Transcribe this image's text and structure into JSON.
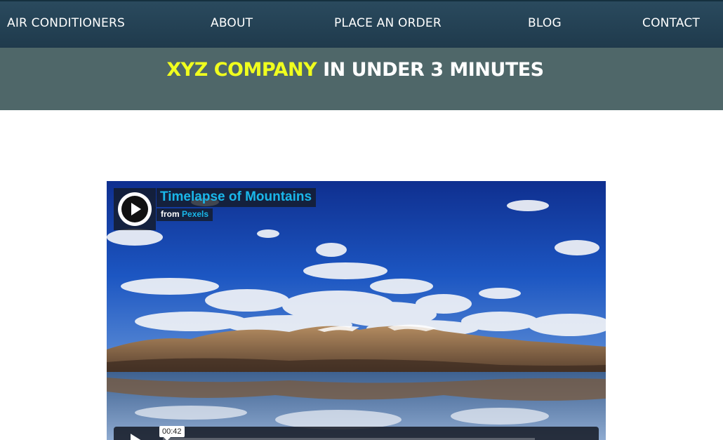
{
  "nav": {
    "items": [
      {
        "label": "AIR CONDITIONERS"
      },
      {
        "label": "ABOUT"
      },
      {
        "label": "PLACE AN ORDER"
      },
      {
        "label": "BLOG"
      },
      {
        "label": "CONTACT"
      }
    ]
  },
  "banner": {
    "title_highlight": "XYZ COMPANY",
    "title_rest": " IN UNDER 3 MINUTES"
  },
  "video": {
    "title": "Timelapse of Mountains",
    "byline_prefix": "from",
    "byline_source": "Pexels",
    "timecode": "00:42",
    "icons": {
      "badge": "play-circle-icon",
      "play": "play-icon"
    }
  },
  "colors": {
    "nav_bg": "#1f3a4c",
    "banner_bg": "#4f6769",
    "highlight": "#f0ff1e",
    "player_accent": "#1ab7ea"
  }
}
